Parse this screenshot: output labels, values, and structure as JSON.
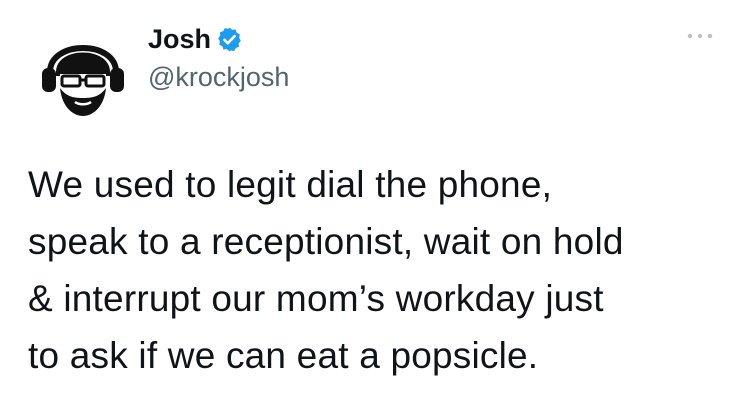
{
  "author": {
    "display_name": "Josh",
    "handle": "@krockjosh",
    "verified": true,
    "avatar_icon": "headphones-glasses-beard-avatar-icon",
    "verified_icon": "verified-badge-icon",
    "verified_color": "#1d9bf0"
  },
  "actions": {
    "more_icon": "more-options-icon"
  },
  "tweet": {
    "lines": [
      "We used to legit dial the phone,",
      "speak to a receptionist, wait on hold",
      "& interrupt our mom’s workday just",
      "to ask if we can eat a popsicle."
    ]
  },
  "colors": {
    "text_primary": "#0f1419",
    "text_secondary": "#536471",
    "background": "#ffffff"
  }
}
